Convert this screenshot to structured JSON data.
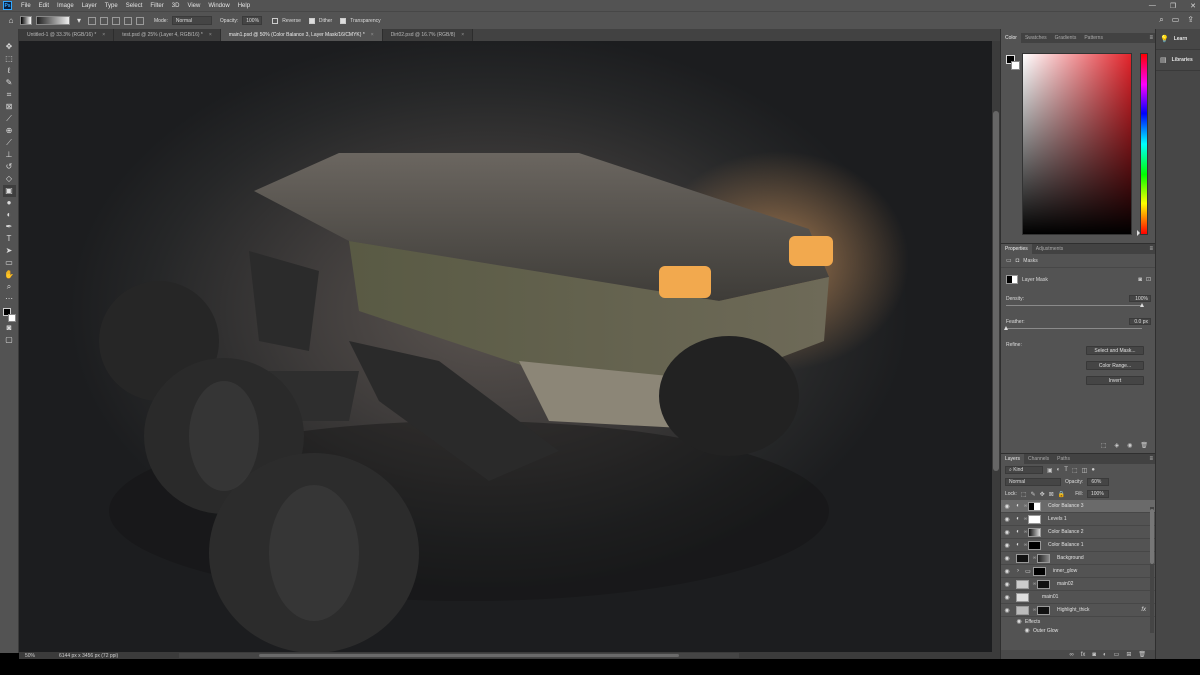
{
  "app": {
    "logo": "Ps"
  },
  "menubar": {
    "items": [
      "File",
      "Edit",
      "Image",
      "Layer",
      "Type",
      "Select",
      "Filter",
      "3D",
      "View",
      "Window",
      "Help"
    ]
  },
  "window_controls": {
    "minimize": "—",
    "restore": "❐",
    "close": "✕"
  },
  "options_bar": {
    "mode_label": "Mode:",
    "mode_value": "Normal",
    "opacity_label": "Opacity:",
    "opacity_value": "100%",
    "reverse_label": "Reverse",
    "dither_label": "Dither",
    "transparency_label": "Transparency",
    "reverse_checked": false,
    "dither_checked": true,
    "transparency_checked": true
  },
  "tabs": [
    {
      "label": "Untitled-1 @ 33.3% (RGB/16) *",
      "active": false
    },
    {
      "label": "test.psd @ 25% (Layer 4, RGB/16) *",
      "active": false
    },
    {
      "label": "main1.psd @ 50% (Color Balance 3, Layer Mask/16/CMYK) *",
      "active": true
    },
    {
      "label": "Dirt02.psd @ 16.7% (RGB/8)",
      "active": false
    }
  ],
  "tools": [
    "move-icon",
    "marquee-icon",
    "lasso-icon",
    "quick-select-icon",
    "crop-icon",
    "frame-icon",
    "eyedropper-icon",
    "healing-icon",
    "brush-icon",
    "stamp-icon",
    "history-brush-icon",
    "eraser-icon",
    "gradient-icon",
    "blur-icon",
    "dodge-icon",
    "pen-icon",
    "type-icon",
    "path-select-icon",
    "shape-icon",
    "hand-icon",
    "zoom-icon",
    "more-icon"
  ],
  "status": {
    "zoom": "50%",
    "doc_info": "6144 px x 3456 px (72 ppi)"
  },
  "color_panel": {
    "tabs": [
      "Color",
      "Swatches",
      "Gradients",
      "Patterns"
    ],
    "active_tab": "Color",
    "hue_color": "#e3242b"
  },
  "properties_panel": {
    "tabs": [
      "Properties",
      "Adjustments"
    ],
    "section_label": "Masks",
    "mask_label": "Layer Mask",
    "density_label": "Density:",
    "density_value": "100%",
    "density": 1.0,
    "feather_label": "Feather:",
    "feather_value": "0.0 px",
    "feather": 0.0,
    "refine_label": "Refine:",
    "buttons": [
      "Select and Mask...",
      "Color Range...",
      "Invert"
    ]
  },
  "layers_panel": {
    "tabs": [
      "Layers",
      "Channels",
      "Paths"
    ],
    "filter_value": "Kind",
    "blend_mode": "Normal",
    "opacity_label": "Opacity:",
    "opacity_value": "60%",
    "lock_label": "Lock:",
    "fill_label": "Fill:",
    "fill_value": "100%",
    "layers": [
      {
        "name": "Color Balance 3",
        "selected": true
      },
      {
        "name": "Levels 1",
        "selected": false
      },
      {
        "name": "Color Balance 2",
        "selected": false
      },
      {
        "name": "Color Balance 1",
        "selected": false
      },
      {
        "name": "Background",
        "selected": false
      },
      {
        "name": "inner_glow",
        "selected": false
      },
      {
        "name": "main02",
        "selected": false
      },
      {
        "name": "main01",
        "selected": false
      },
      {
        "name": "Highlight_thick",
        "selected": false,
        "fx": "fx"
      }
    ],
    "effects_label": "Effects",
    "effect_items": [
      "Outer Glow"
    ]
  },
  "dock": {
    "items": [
      {
        "label": "Learn",
        "icon": "lightbulb-icon"
      },
      {
        "label": "Libraries",
        "icon": "libraries-icon"
      }
    ]
  },
  "colors": {
    "ui_dark": "#535353",
    "canvas_bg": "#262728",
    "accent": "#31a8ff"
  }
}
